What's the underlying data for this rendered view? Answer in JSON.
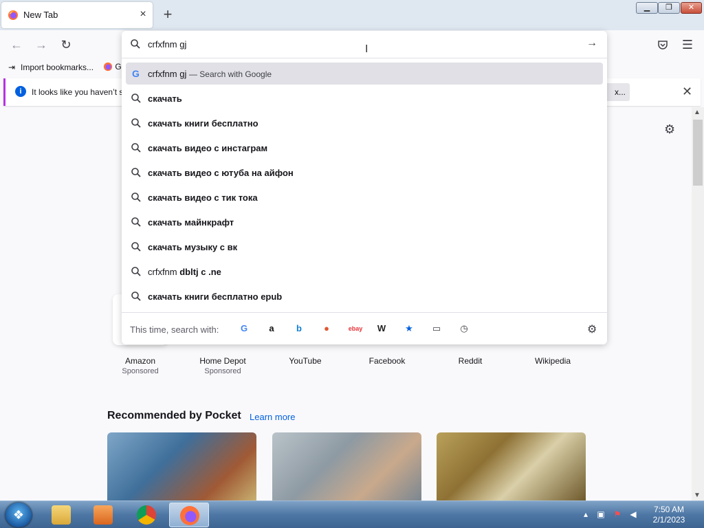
{
  "tab": {
    "title": "New Tab",
    "close": "×"
  },
  "newtab_symbol": "+",
  "window_buttons": {
    "minimize": "▁",
    "maximize": "❐",
    "close": "✕"
  },
  "bookmarks": {
    "import_label": "Import bookmarks...",
    "second_label": "G"
  },
  "notice": {
    "message": "It looks like you haven’t s",
    "button_label": "x...",
    "close": "✕"
  },
  "urlbar": {
    "value": "crfxfnm gj",
    "go_symbol": "→",
    "suggestions": [
      {
        "type": "search",
        "prefix": "crfxfnm gj",
        "text": "",
        "sub": "— Search with Google",
        "selected": true
      },
      {
        "type": "suggestion",
        "prefix": "",
        "text": "скачать",
        "sub": ""
      },
      {
        "type": "suggestion",
        "prefix": "",
        "text": "скачать книги бесплатно",
        "sub": ""
      },
      {
        "type": "suggestion",
        "prefix": "",
        "text": "скачать видео с инстаграм",
        "sub": ""
      },
      {
        "type": "suggestion",
        "prefix": "",
        "text": "скачать видео с ютуба на айфон",
        "sub": ""
      },
      {
        "type": "suggestion",
        "prefix": "",
        "text": "скачать видео с тик тока",
        "sub": ""
      },
      {
        "type": "suggestion",
        "prefix": "",
        "text": "скачать майнкрафт",
        "sub": ""
      },
      {
        "type": "suggestion",
        "prefix": "",
        "text": "скачать музыку с вк",
        "sub": ""
      },
      {
        "type": "suggestion",
        "prefix": "crfxfnm ",
        "text": "dbltj c .ne",
        "sub": ""
      },
      {
        "type": "suggestion",
        "prefix": "",
        "text": "скачать книги бесплатно epub",
        "sub": ""
      }
    ],
    "search_with_label": "This time, search with:",
    "engines": [
      {
        "name": "google-icon",
        "glyph": "G",
        "color": "#4285f4"
      },
      {
        "name": "amazon-icon",
        "glyph": "a",
        "color": "#111111"
      },
      {
        "name": "bing-icon",
        "glyph": "b",
        "color": "#0f7fd8"
      },
      {
        "name": "duckduckgo-icon",
        "glyph": "●",
        "color": "#de5833"
      },
      {
        "name": "ebay-icon",
        "glyph": "ebay",
        "color": "#e53238"
      },
      {
        "name": "wikipedia-icon",
        "glyph": "W",
        "color": "#222222"
      },
      {
        "name": "bookmarks-star-icon",
        "glyph": "★",
        "color": "#0060df"
      },
      {
        "name": "tabs-icon",
        "glyph": "▭",
        "color": "#3d3d45"
      },
      {
        "name": "history-icon",
        "glyph": "◷",
        "color": "#3d3d45"
      }
    ]
  },
  "top_sites": [
    {
      "name": "Amazon",
      "sponsored": "Sponsored"
    },
    {
      "name": "Home Depot",
      "sponsored": "Sponsored"
    },
    {
      "name": "YouTube",
      "sponsored": ""
    },
    {
      "name": "Facebook",
      "sponsored": ""
    },
    {
      "name": "Reddit",
      "sponsored": ""
    },
    {
      "name": "Wikipedia",
      "sponsored": ""
    }
  ],
  "pocket": {
    "title": "Recommended by Pocket",
    "learn_more": "Learn more"
  },
  "taskbar": {
    "time": "7:50 AM",
    "date": "2/1/2023"
  }
}
